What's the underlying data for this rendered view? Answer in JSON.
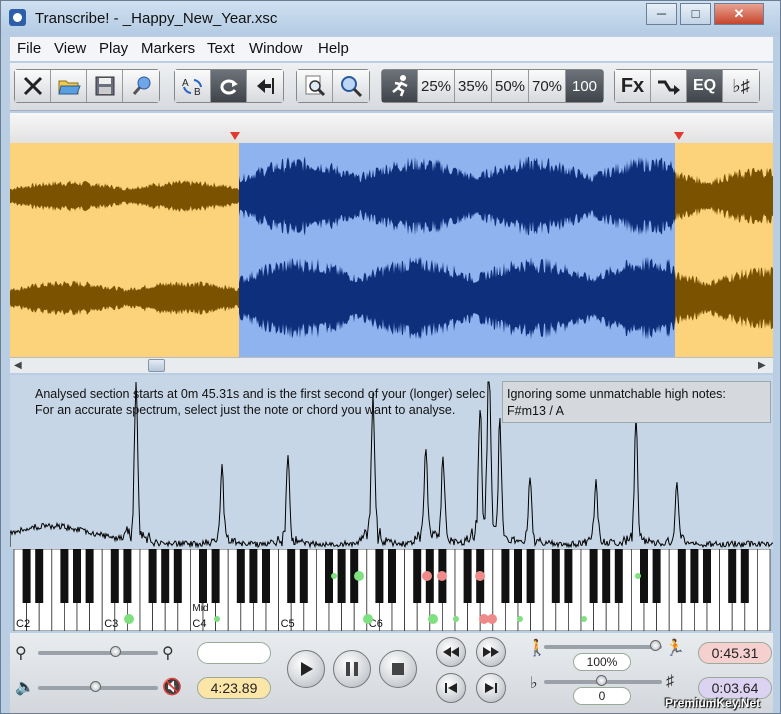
{
  "window": {
    "title": "Transcribe! - _Happy_New_Year.xsc"
  },
  "menu": [
    "File",
    "View",
    "Play",
    "Markers",
    "Text",
    "Window",
    "Help"
  ],
  "toolbar": {
    "speed_buttons": [
      "25%",
      "35%",
      "50%",
      "70%",
      "100"
    ],
    "fx_label": "Fx",
    "eq_label": "EQ",
    "key_label": "♭♯"
  },
  "analysis": {
    "line1": "Analysed section starts at 0m 45.31s and is the first second of your (longer) selec",
    "line2": "For an accurate spectrum, select just the note or chord you want to analyse.",
    "chord_line1": "Ignoring some unmatchable high notes:",
    "chord_line2": "F#m13 / A"
  },
  "piano": {
    "labels": [
      {
        "text": "C2",
        "octave_index": 0
      },
      {
        "text": "C3",
        "octave_index": 1
      },
      {
        "text": "C4",
        "octave_index": 2
      },
      {
        "text": "C5",
        "octave_index": 3
      },
      {
        "text": "C6",
        "octave_index": 4
      }
    ],
    "mid_label": "Mid"
  },
  "colors": {
    "unselected_bg": "#fcd27a",
    "unselected_wave": "#7a5200",
    "selected_bg": "#8fb3ef",
    "selected_wave": "#0e2f7c",
    "marker": "#e03b2e",
    "green_dot": "#7fe07f",
    "red_dot": "#ef8a8a"
  },
  "controls": {
    "position_time": "4:23.89",
    "speed_value": "100%",
    "pitch_value": "0",
    "selection_start": "0:45.31",
    "selection_length": "0:03.64"
  },
  "watermark": "PremiumKey.Net"
}
